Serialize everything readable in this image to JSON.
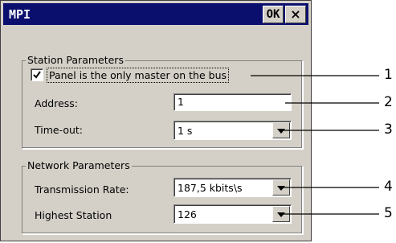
{
  "dialog": {
    "title": "MPI",
    "ok_label": "OK",
    "close_label": "×"
  },
  "station": {
    "legend": "Station Parameters",
    "only_master_label": "Panel is the only master on the bus",
    "only_master_checked": true,
    "address_label": "Address:",
    "address_value": "1",
    "timeout_label": "Time-out:",
    "timeout_value": "1 s"
  },
  "network": {
    "legend": "Network Parameters",
    "rate_label": "Transmission Rate:",
    "rate_value": "187,5 kbits\\s",
    "highest_label": "Highest Station",
    "highest_value": "126"
  },
  "callouts": [
    "1",
    "2",
    "3",
    "4",
    "5"
  ]
}
